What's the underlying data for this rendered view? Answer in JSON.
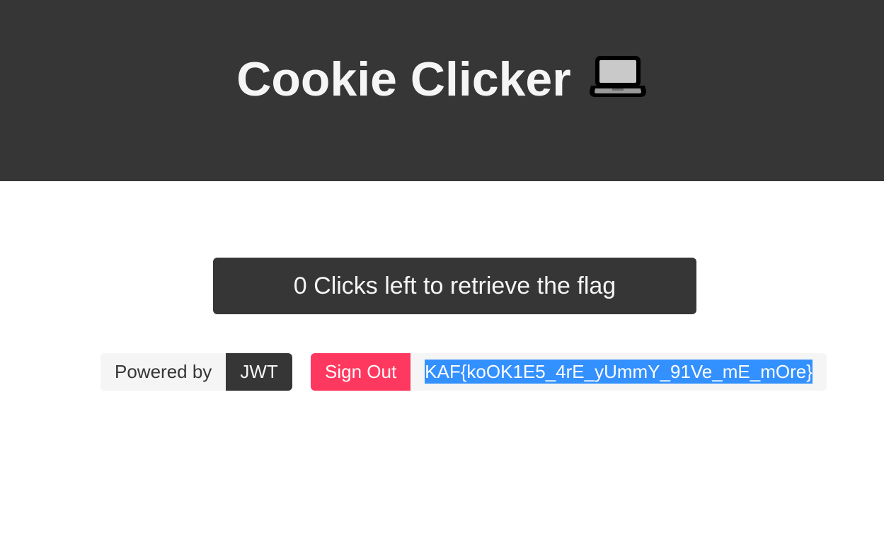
{
  "header": {
    "title": "Cookie Clicker",
    "icon": "laptop-icon"
  },
  "main": {
    "clicks_text": "0 Clicks left to retrieve the flag",
    "powered_by_label": "Powered by",
    "powered_by_value": "JWT",
    "sign_out_label": "Sign Out",
    "flag": "KAF{koOK1E5_4rE_yUmmY_91Ve_mE_mOre}"
  },
  "colors": {
    "dark": "#363636",
    "light": "#f5f5f5",
    "danger": "#ff3860",
    "selection": "#3390ff"
  }
}
